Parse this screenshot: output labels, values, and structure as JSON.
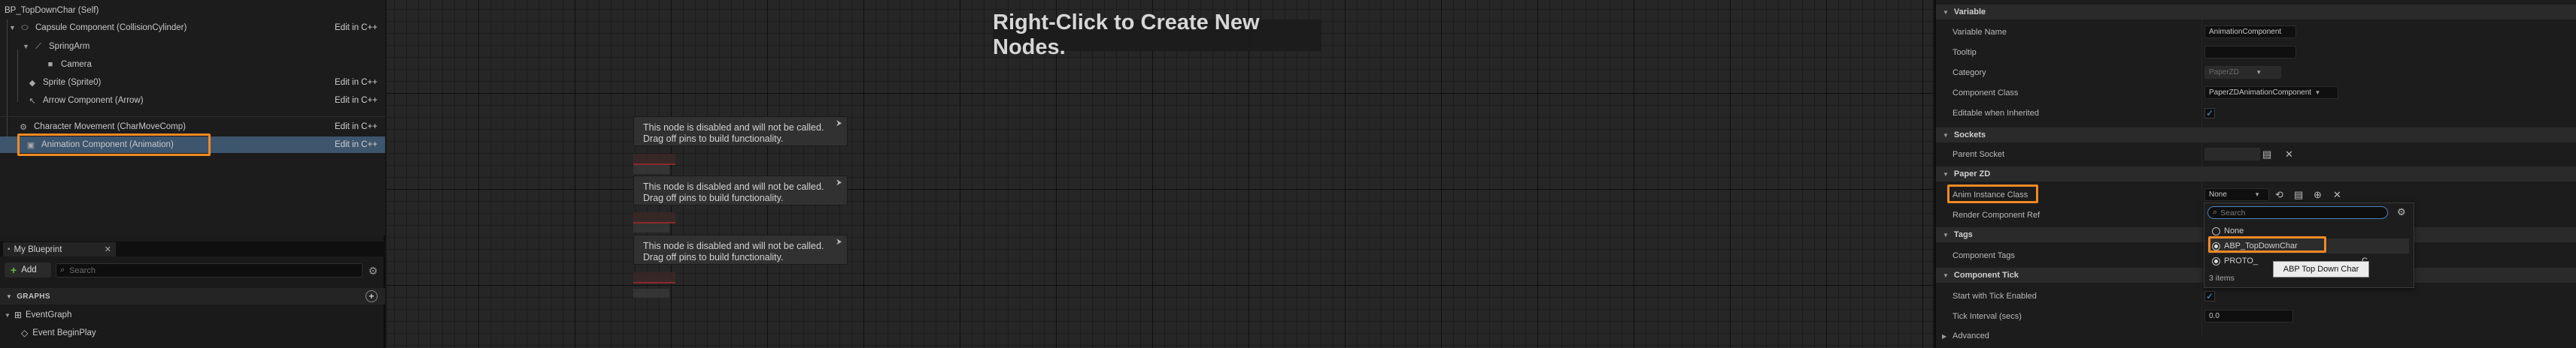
{
  "component_tree": {
    "root": "BP_TopDownChar (Self)",
    "items": [
      {
        "label": "Capsule Component (CollisionCylinder)",
        "edit": "Edit in C++"
      },
      {
        "label": "SpringArm",
        "edit": ""
      },
      {
        "label": "Camera",
        "edit": ""
      },
      {
        "label": "Sprite (Sprite0)",
        "edit": "Edit in C++"
      },
      {
        "label": "Arrow Component (Arrow)",
        "edit": "Edit in C++"
      },
      {
        "label": "Character Movement (CharMoveComp)",
        "edit": "Edit in C++"
      },
      {
        "label": "Animation Component (Animation)",
        "edit": "Edit in C++"
      }
    ]
  },
  "my_blueprint": {
    "tab_label": "My Blueprint",
    "add_label": "Add",
    "search_placeholder": "Search",
    "graphs_header": "GRAPHS",
    "event_graph": "EventGraph",
    "event_begin_play": "Event BeginPlay"
  },
  "graph": {
    "hint": "Right-Click to Create New Nodes.",
    "disabled_nodes": [
      {
        "line1": "This node is disabled and will not be called.",
        "line2": "Drag off pins to build functionality."
      },
      {
        "line1": "This node is disabled and will not be called.",
        "line2": "Drag off pins to build functionality."
      },
      {
        "line1": "This node is disabled and will not be called.",
        "line2": "Drag off pins to build functionality."
      }
    ]
  },
  "details": {
    "variable": {
      "header": "Variable",
      "name_label": "Variable Name",
      "name_value": "AnimationComponent",
      "tooltip_label": "Tooltip",
      "category_label": "Category",
      "category_value": "PaperZD",
      "class_label": "Component Class",
      "class_value": "PaperZDAnimationComponent",
      "editable_label": "Editable when Inherited",
      "editable_checked": true
    },
    "sockets": {
      "header": "Sockets",
      "parent_label": "Parent Socket"
    },
    "paper_zd": {
      "header": "Paper ZD",
      "anim_label": "Anim Instance Class",
      "anim_value": "None",
      "render_label": "Render Component Ref"
    },
    "tags": {
      "header": "Tags",
      "component_tags_label": "Component Tags"
    },
    "component_tick": {
      "header": "Component Tick",
      "start_label": "Start with Tick Enabled",
      "start_checked": true,
      "interval_label": "Tick Interval (secs)",
      "interval_value": "0.0"
    },
    "advanced_label": "Advanced"
  },
  "popup": {
    "search_placeholder": "Search",
    "options": [
      "None",
      "ABP_TopDownChar",
      "PROTO_"
    ],
    "options_suffix": "C",
    "count": "3 items",
    "tooltip": "ABP Top Down Char"
  },
  "colors": {
    "highlight": "#f08a24",
    "selection": "#3e556e",
    "accent_blue": "#4f9cdc"
  }
}
